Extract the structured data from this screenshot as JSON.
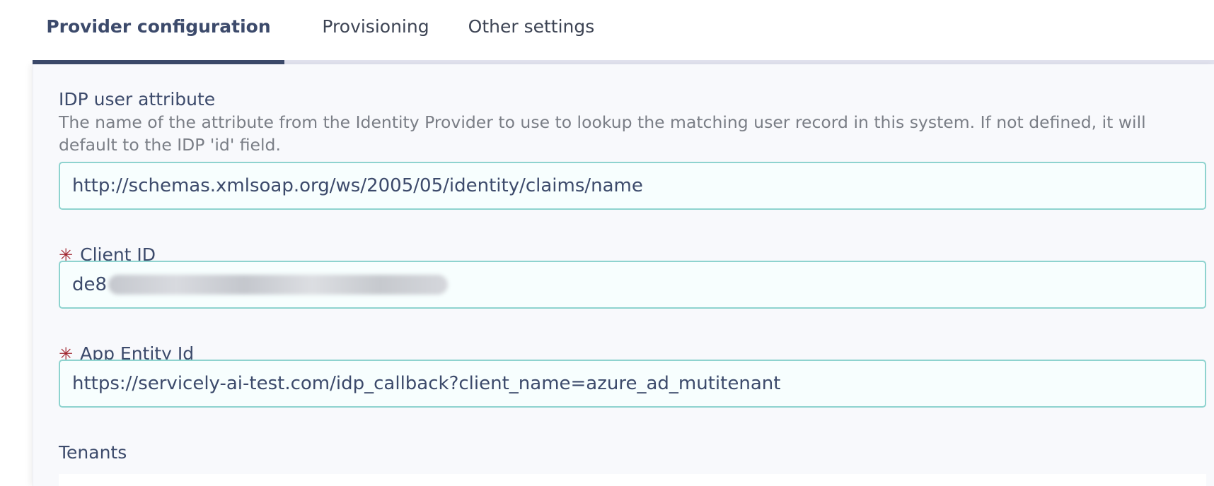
{
  "tabs": [
    {
      "label": "Provider configuration",
      "active": true
    },
    {
      "label": "Provisioning",
      "active": false
    },
    {
      "label": "Other settings",
      "active": false
    }
  ],
  "fields": {
    "idp_user_attribute": {
      "label": "IDP user attribute",
      "description": "The name of the attribute from the Identity Provider to use to lookup the matching user record in this system. If not defined, it will default to the IDP 'id' field.",
      "value": "http://schemas.xmlsoap.org/ws/2005/05/identity/claims/name"
    },
    "client_id": {
      "label": "Client ID",
      "required_marker": "✳",
      "value": "de8"
    },
    "app_entity_id": {
      "label": "App Entity Id",
      "required_marker": "✳",
      "value": "https://servicely-ai-test.com/idp_callback?client_name=azure_ad_mutitenant"
    },
    "tenants": {
      "label": "Tenants"
    }
  },
  "colors": {
    "primary": "#3c4a6b",
    "input_border": "#8ed3cf",
    "required": "#a0242e",
    "tab_track": "#e1e2ee"
  }
}
